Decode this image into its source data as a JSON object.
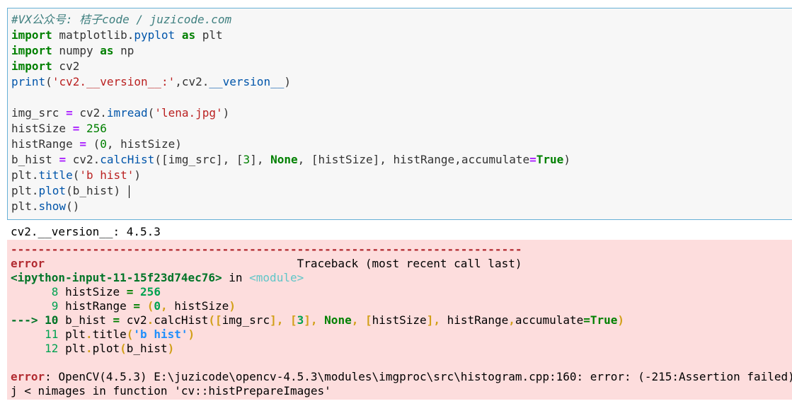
{
  "input_cell": {
    "lines": [
      [
        {
          "t": "#VX公众号: 桔子code / juzicode.com",
          "c": "cm"
        }
      ],
      [
        {
          "t": "import",
          "c": "kw"
        },
        {
          "t": " matplotlib.",
          "c": ""
        },
        {
          "t": "pyplot",
          "c": "fn"
        },
        {
          "t": " ",
          "c": ""
        },
        {
          "t": "as",
          "c": "kw"
        },
        {
          "t": " plt",
          "c": ""
        }
      ],
      [
        {
          "t": "import",
          "c": "kw"
        },
        {
          "t": " numpy ",
          "c": ""
        },
        {
          "t": "as",
          "c": "kw"
        },
        {
          "t": " np",
          "c": ""
        }
      ],
      [
        {
          "t": "import",
          "c": "kw"
        },
        {
          "t": " cv2",
          "c": ""
        }
      ],
      [
        {
          "t": "print",
          "c": "fn"
        },
        {
          "t": "(",
          "c": ""
        },
        {
          "t": "'cv2.__version__:'",
          "c": "st"
        },
        {
          "t": ",cv2.",
          "c": ""
        },
        {
          "t": "__version__",
          "c": "fn"
        },
        {
          "t": ")",
          "c": ""
        }
      ],
      [
        {
          "t": "",
          "c": ""
        }
      ],
      [
        {
          "t": "img_src ",
          "c": ""
        },
        {
          "t": "=",
          "c": "op"
        },
        {
          "t": " cv2.",
          "c": ""
        },
        {
          "t": "imread",
          "c": "fn"
        },
        {
          "t": "(",
          "c": ""
        },
        {
          "t": "'lena.jpg'",
          "c": "st"
        },
        {
          "t": ")",
          "c": ""
        }
      ],
      [
        {
          "t": "histSize ",
          "c": ""
        },
        {
          "t": "=",
          "c": "op"
        },
        {
          "t": " ",
          "c": ""
        },
        {
          "t": "256",
          "c": "nu"
        }
      ],
      [
        {
          "t": "histRange ",
          "c": ""
        },
        {
          "t": "=",
          "c": "op"
        },
        {
          "t": " (",
          "c": ""
        },
        {
          "t": "0",
          "c": "nu"
        },
        {
          "t": ", histSize)",
          "c": ""
        }
      ],
      [
        {
          "t": "b_hist ",
          "c": ""
        },
        {
          "t": "=",
          "c": "op"
        },
        {
          "t": " cv2.",
          "c": ""
        },
        {
          "t": "calcHist",
          "c": "fn"
        },
        {
          "t": "([img_src], [",
          "c": ""
        },
        {
          "t": "3",
          "c": "nu"
        },
        {
          "t": "], ",
          "c": ""
        },
        {
          "t": "None",
          "c": "kw"
        },
        {
          "t": ", [histSize], histRange,accumulate",
          "c": ""
        },
        {
          "t": "=",
          "c": "op"
        },
        {
          "t": "True",
          "c": "kw"
        },
        {
          "t": ")",
          "c": ""
        }
      ],
      [
        {
          "t": "plt.",
          "c": ""
        },
        {
          "t": "title",
          "c": "fn"
        },
        {
          "t": "(",
          "c": ""
        },
        {
          "t": "'b hist'",
          "c": "st"
        },
        {
          "t": ")",
          "c": ""
        }
      ],
      [
        {
          "t": "plt.",
          "c": ""
        },
        {
          "t": "plot",
          "c": "fn"
        },
        {
          "t": "(b_hist) ",
          "c": ""
        },
        {
          "t": "",
          "c": "cursor"
        }
      ],
      [
        {
          "t": "plt.",
          "c": ""
        },
        {
          "t": "show",
          "c": "fn"
        },
        {
          "t": "()",
          "c": ""
        }
      ]
    ]
  },
  "stdout": "cv2.__version__: 4.5.3",
  "traceback": {
    "lines": [
      [
        {
          "t": "---------------------------------------------------------------------------",
          "c": "e-red"
        }
      ],
      [
        {
          "t": "error",
          "c": "e-red"
        },
        {
          "t": "                                     Traceback (most recent call last)",
          "c": ""
        }
      ],
      [
        {
          "t": "<ipython-input-11-15f23d74ec76>",
          "c": "e-green"
        },
        {
          "t": " in ",
          "c": ""
        },
        {
          "t": "<module>",
          "c": "e-cyan"
        }
      ],
      [
        {
          "t": "      8",
          "c": "e-gl"
        },
        {
          "t": " histSize ",
          "c": ""
        },
        {
          "t": "=",
          "c": "e-grn2"
        },
        {
          "t": " ",
          "c": ""
        },
        {
          "t": "256",
          "c": "e-num"
        }
      ],
      [
        {
          "t": "      9",
          "c": "e-gl"
        },
        {
          "t": " histRange ",
          "c": ""
        },
        {
          "t": "=",
          "c": "e-grn2"
        },
        {
          "t": " ",
          "c": ""
        },
        {
          "t": "(",
          "c": "e-yel"
        },
        {
          "t": "0",
          "c": "e-num"
        },
        {
          "t": ",",
          "c": "e-yel"
        },
        {
          "t": " histSize",
          "c": ""
        },
        {
          "t": ")",
          "c": "e-yel"
        }
      ],
      [
        {
          "t": "---> 10",
          "c": "e-green"
        },
        {
          "t": " b_hist ",
          "c": ""
        },
        {
          "t": "=",
          "c": "e-grn2"
        },
        {
          "t": " cv2",
          "c": ""
        },
        {
          "t": ".",
          "c": "e-yel"
        },
        {
          "t": "calcHist",
          "c": ""
        },
        {
          "t": "([",
          "c": "e-yel"
        },
        {
          "t": "img_src",
          "c": ""
        },
        {
          "t": "],",
          "c": "e-yel"
        },
        {
          "t": " ",
          "c": ""
        },
        {
          "t": "[",
          "c": "e-yel"
        },
        {
          "t": "3",
          "c": "e-num"
        },
        {
          "t": "],",
          "c": "e-yel"
        },
        {
          "t": " ",
          "c": ""
        },
        {
          "t": "None",
          "c": "e-grn2"
        },
        {
          "t": ",",
          "c": "e-yel"
        },
        {
          "t": " ",
          "c": ""
        },
        {
          "t": "[",
          "c": "e-yel"
        },
        {
          "t": "histSize",
          "c": ""
        },
        {
          "t": "],",
          "c": "e-yel"
        },
        {
          "t": " histRange",
          "c": ""
        },
        {
          "t": ",",
          "c": "e-yel"
        },
        {
          "t": "accumulate",
          "c": ""
        },
        {
          "t": "=",
          "c": "e-grn2"
        },
        {
          "t": "True",
          "c": "e-grn2"
        },
        {
          "t": ")",
          "c": "e-yel"
        }
      ],
      [
        {
          "t": "     11",
          "c": "e-gl"
        },
        {
          "t": " plt",
          "c": ""
        },
        {
          "t": ".",
          "c": "e-yel"
        },
        {
          "t": "title",
          "c": ""
        },
        {
          "t": "(",
          "c": "e-yel"
        },
        {
          "t": "'b hist'",
          "c": "e-blue"
        },
        {
          "t": ")",
          "c": "e-yel"
        }
      ],
      [
        {
          "t": "     12",
          "c": "e-gl"
        },
        {
          "t": " plt",
          "c": ""
        },
        {
          "t": ".",
          "c": "e-yel"
        },
        {
          "t": "plot",
          "c": ""
        },
        {
          "t": "(",
          "c": "e-yel"
        },
        {
          "t": "b_hist",
          "c": ""
        },
        {
          "t": ")",
          "c": "e-yel"
        }
      ],
      [
        {
          "t": "",
          "c": ""
        }
      ],
      [
        {
          "t": "error",
          "c": "e-red"
        },
        {
          "t": ": OpenCV(4.5.3) E:\\juzicode\\opencv-4.5.3\\modules\\imgproc\\src\\histogram.cpp:160: error: (-215:Assertion failed)",
          "c": ""
        }
      ],
      [
        {
          "t": "j < nimages in function 'cv::histPrepareImages'",
          "c": ""
        }
      ]
    ]
  }
}
